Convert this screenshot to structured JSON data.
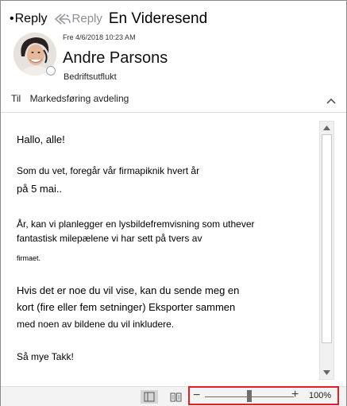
{
  "actions": {
    "reply_label": "Reply",
    "reply_bullet": "•",
    "reply_all_label": "Reply",
    "forward_label": "En Videresend"
  },
  "header": {
    "date": "Fre 4/6/2018 10:23 AM",
    "sender": "Andre Parsons",
    "subject": "Bedriftsutflukt",
    "to_label": "Til",
    "to_value": "Markedsføring avdeling"
  },
  "message": {
    "lines": [
      "Hallo, alle!",
      "Som du vet, foregår vår firmapiknik hvert år",
      "på 5 mai..",
      "År, kan vi planlegger en lysbildefremvisning som uthever",
      "fantastisk milepælene vi har sett på tvers av",
      "firmaet.",
      "Hvis det er noe du vil vise, kan du sende meg en",
      "kort (fire eller fem setninger) Eksporter sammen",
      "med noen av bildene du vil inkludere.",
      "Så mye Takk!"
    ]
  },
  "statusbar": {
    "zoom_minus": "−",
    "zoom_plus": "+",
    "zoom_level": "100%",
    "zoom_fraction": 0.5
  },
  "colors": {
    "highlight_border": "#e01f26",
    "reply_all_icon": "#8e8e8e",
    "forward_icon_accent": "#8a4fd0"
  },
  "icons": [
    "reply-all-icon",
    "chevron-up-icon",
    "scroll-up-icon",
    "scroll-down-icon",
    "normal-view-icon",
    "reading-view-icon",
    "presence-icon"
  ]
}
